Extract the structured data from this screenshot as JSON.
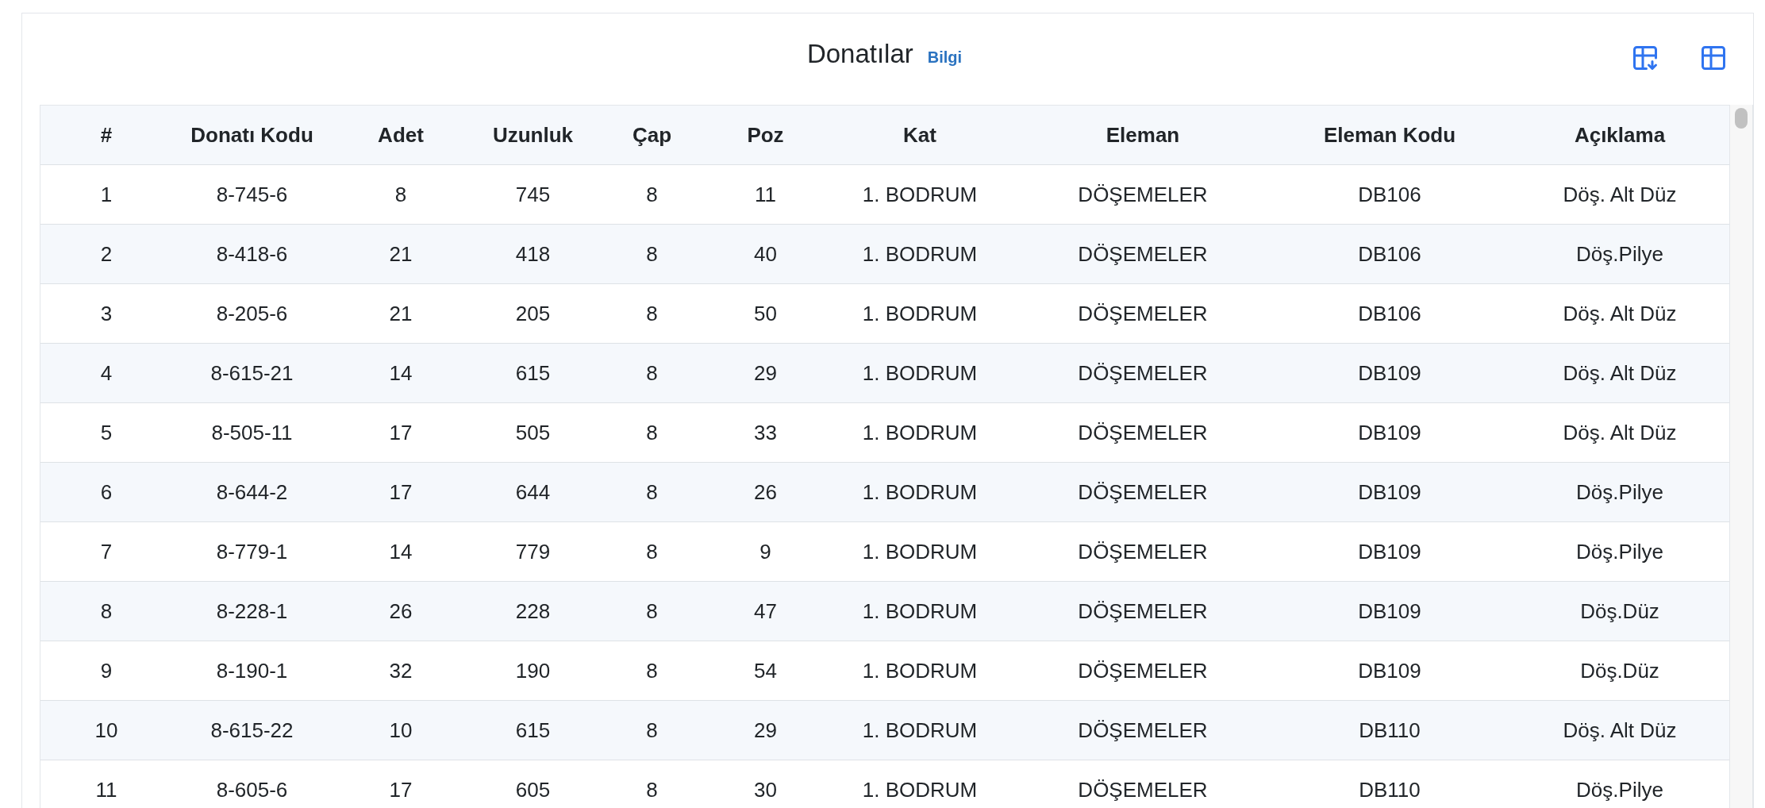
{
  "panel": {
    "title": "Donatılar",
    "info_link": "Bilgi"
  },
  "table": {
    "columns": [
      "#",
      "Donatı Kodu",
      "Adet",
      "Uzunluk",
      "Çap",
      "Poz",
      "Kat",
      "Eleman",
      "Eleman Kodu",
      "Açıklama"
    ],
    "rows": [
      [
        "1",
        "8-745-6",
        "8",
        "745",
        "8",
        "11",
        "1. BODRUM",
        "DÖŞEMELER",
        "DB106",
        "Döş. Alt Düz"
      ],
      [
        "2",
        "8-418-6",
        "21",
        "418",
        "8",
        "40",
        "1. BODRUM",
        "DÖŞEMELER",
        "DB106",
        "Döş.Pilye"
      ],
      [
        "3",
        "8-205-6",
        "21",
        "205",
        "8",
        "50",
        "1. BODRUM",
        "DÖŞEMELER",
        "DB106",
        "Döş. Alt Düz"
      ],
      [
        "4",
        "8-615-21",
        "14",
        "615",
        "8",
        "29",
        "1. BODRUM",
        "DÖŞEMELER",
        "DB109",
        "Döş. Alt Düz"
      ],
      [
        "5",
        "8-505-11",
        "17",
        "505",
        "8",
        "33",
        "1. BODRUM",
        "DÖŞEMELER",
        "DB109",
        "Döş. Alt Düz"
      ],
      [
        "6",
        "8-644-2",
        "17",
        "644",
        "8",
        "26",
        "1. BODRUM",
        "DÖŞEMELER",
        "DB109",
        "Döş.Pilye"
      ],
      [
        "7",
        "8-779-1",
        "14",
        "779",
        "8",
        "9",
        "1. BODRUM",
        "DÖŞEMELER",
        "DB109",
        "Döş.Pilye"
      ],
      [
        "8",
        "8-228-1",
        "26",
        "228",
        "8",
        "47",
        "1. BODRUM",
        "DÖŞEMELER",
        "DB109",
        "Döş.Düz"
      ],
      [
        "9",
        "8-190-1",
        "32",
        "190",
        "8",
        "54",
        "1. BODRUM",
        "DÖŞEMELER",
        "DB109",
        "Döş.Düz"
      ],
      [
        "10",
        "8-615-22",
        "10",
        "615",
        "8",
        "29",
        "1. BODRUM",
        "DÖŞEMELER",
        "DB110",
        "Döş. Alt Düz"
      ],
      [
        "11",
        "8-605-6",
        "17",
        "605",
        "8",
        "30",
        "1. BODRUM",
        "DÖŞEMELER",
        "DB110",
        "Döş.Pilye"
      ]
    ]
  }
}
